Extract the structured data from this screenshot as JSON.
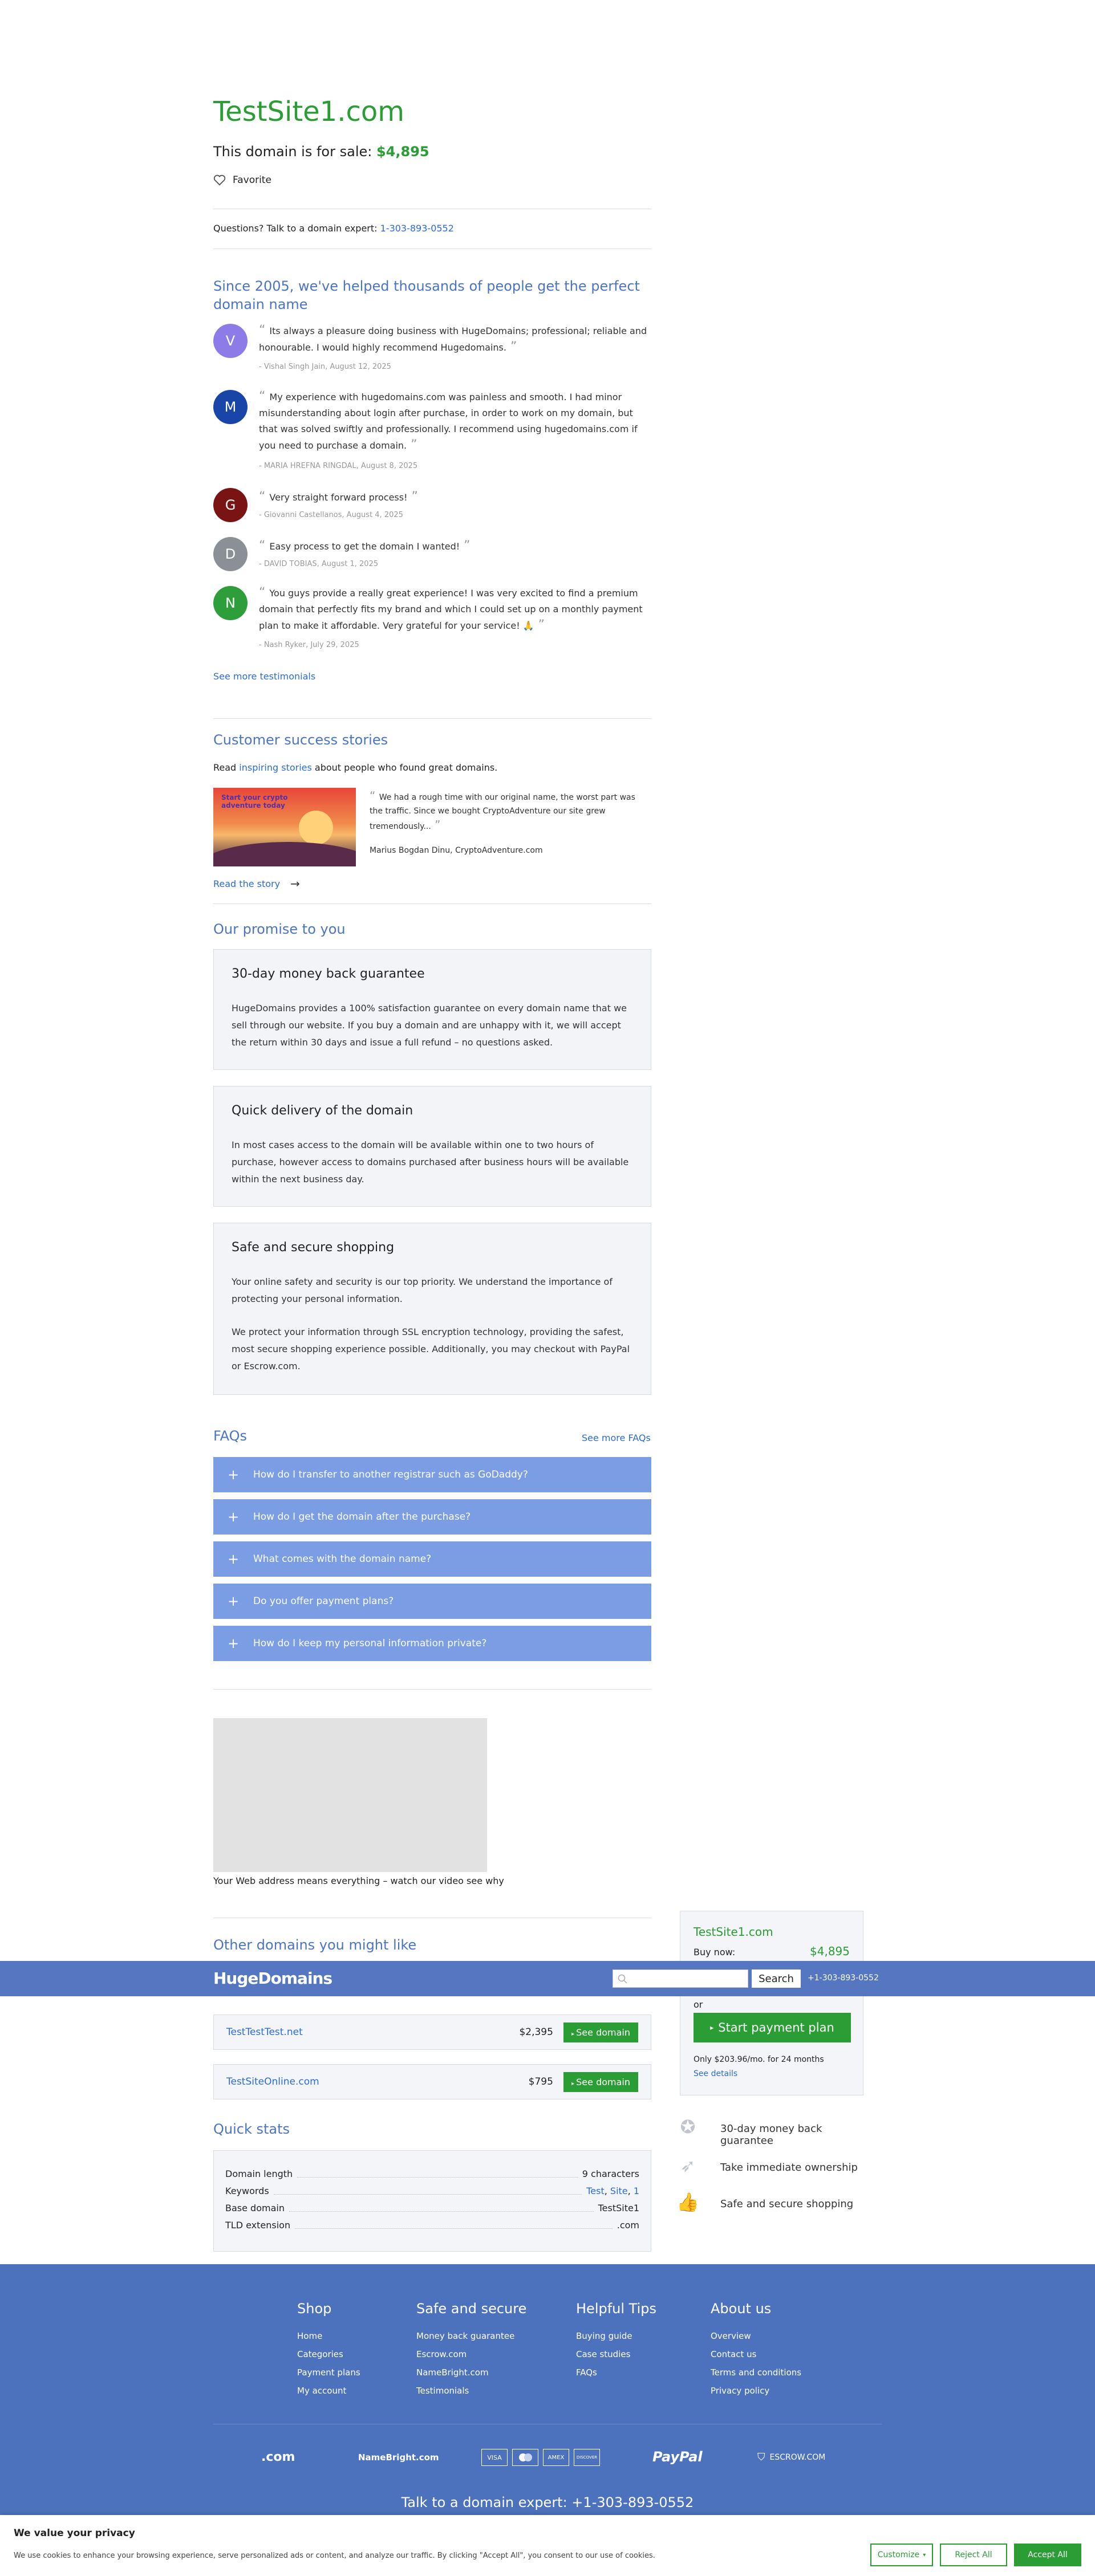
{
  "domain_title": "TestSite1.com",
  "sale_prefix": "This domain is for sale: ",
  "sale_price": "$4,895",
  "favorite": "Favorite",
  "questions_prefix": "Questions? Talk to a domain expert: ",
  "questions_phone": "1-303-893-0552",
  "testimonials_heading": "Since 2005, we've helped thousands of people get the perfect domain name",
  "testimonials": [
    {
      "initial": "V",
      "color": "#8d7ce8",
      "text": "Its always a pleasure doing business with HugeDomains; professional; reliable and honourable. I would highly recommend Hugedomains.",
      "meta": "- Vishal Singh Jain, August 12, 2025"
    },
    {
      "initial": "M",
      "color": "#1a45a8",
      "text": "My experience with hugedomains.com was painless and smooth. I had minor misunderstanding about login after purchase, in order to work on my domain, but that was solved swiftly and professionally. I recommend using hugedomains.com if you need to purchase a domain.",
      "meta": "- MARIA HREFNA RINGDAL, August 8, 2025"
    },
    {
      "initial": "G",
      "color": "#7a1414",
      "text": "Very straight forward process!",
      "meta": "- Giovanni Castellanos, August 4, 2025"
    },
    {
      "initial": "D",
      "color": "#8a9096",
      "text": "Easy process to get the domain I wanted!",
      "meta": "- DAVID TOBIAS, August 1, 2025"
    },
    {
      "initial": "N",
      "color": "#2e9e3a",
      "text": "You guys provide a really great experience! I was very excited to find a premium domain that perfectly fits my brand and which I could set up on a monthly payment plan to make it affordable. Very grateful for your service! 🙏",
      "meta": "- Nash Ryker, July 29, 2025"
    }
  ],
  "see_more_testimonials": "See more testimonials",
  "success_heading": "Customer success stories",
  "success_read": "Read ",
  "success_link": "inspiring stories",
  "success_rest": " about people who found great domains.",
  "success_image_text": "Start your crypto adventure today",
  "success_quote": "We had a rough time with our original name, the worst part was the traffic. Since we bought CryptoAdventure our site grew tremendously...",
  "success_author": "Marius Bogdan Dinu, CryptoAdventure.com",
  "read_story": "Read the story",
  "promise_heading": "Our promise to you",
  "promises": [
    {
      "title": "30-day money back guarantee",
      "text": "HugeDomains provides a 100% satisfaction guarantee on every domain name that we sell through our website. If you buy a domain and are unhappy with it, we will accept the return within 30 days and issue a full refund – no questions asked."
    },
    {
      "title": "Quick delivery of the domain",
      "text": "In most cases access to the domain will be available within one to two hours of purchase, however access to domains purchased after business hours will be available within the next business day."
    },
    {
      "title": "Safe and secure shopping",
      "text": "Your online safety and security is our top priority. We understand the importance of protecting your personal information.",
      "text2": "We protect your information through SSL encryption technology, providing the safest, most secure shopping experience possible. Additionally, you may checkout with PayPal or Escrow.com."
    }
  ],
  "faq_heading": "FAQs",
  "see_more_faqs": "See more FAQs",
  "faqs": [
    "How do I transfer to another registrar such as GoDaddy?",
    "How do I get the domain after the purchase?",
    "What comes with the domain name?",
    "Do you offer payment plans?",
    "How do I keep my personal information private?"
  ],
  "video_caption": "Your Web address means everything – watch our video see why",
  "other_heading": "Other domains you might like",
  "header_logo": "HugeDomains",
  "header_search_button": "Search",
  "header_phone": "+1-303-893-0552",
  "other_domains": [
    {
      "name": "TestTestTest.net",
      "price": "$2,395",
      "button": "See domain"
    },
    {
      "name": "TestSiteOnline.com",
      "price": "$795",
      "button": "See domain"
    }
  ],
  "stats_heading": "Quick stats",
  "stats": {
    "domain_length_k": "Domain length",
    "domain_length_v": "9 characters",
    "keywords_k": "Keywords",
    "kw1": "Test",
    "kw2": "Site",
    "kw3": "1",
    "base_k": "Base domain",
    "base_v": "TestSite1",
    "tld_k": "TLD extension",
    "tld_v": ".com"
  },
  "side": {
    "name": "TestSite1.com",
    "buy_now": "Buy now:",
    "price": "$4,895",
    "or": "or",
    "plan_button": "Start payment plan",
    "monthly": "Only $203.96/mo. for 24 months",
    "details": "See details"
  },
  "benefits": [
    "30-day money back guarantee",
    "Take immediate ownership",
    "Safe and secure shopping"
  ],
  "footer": {
    "cols": [
      {
        "title": "Shop",
        "links": [
          "Home",
          "Categories",
          "Payment plans",
          "My account"
        ]
      },
      {
        "title": "Safe and secure",
        "links": [
          "Money back guarantee",
          "Escrow.com",
          "NameBright.com",
          "Testimonials"
        ]
      },
      {
        "title": "Helpful Tips",
        "links": [
          "Buying guide",
          "Case studies",
          "FAQs"
        ]
      },
      {
        "title": "About us",
        "links": [
          "Overview",
          "Contact us",
          "Terms and conditions",
          "Privacy policy"
        ]
      }
    ],
    "logos": {
      "dotcom": ".com",
      "namebright": "NameBright.com",
      "visa": "VISA",
      "amex": "AMEX",
      "discover": "DISCOVER",
      "paypal": "PayPal",
      "escrow": "ESCROW.COM"
    },
    "expert": "Talk to a domain expert: +1-303-893-0552"
  },
  "cookie": {
    "title": "We value your privacy",
    "text": "We use cookies to enhance your browsing experience, serve personalized ads or content, and analyze our traffic. By clicking \"Accept All\", you consent to our use of cookies.",
    "customize": "Customize",
    "reject": "Reject All",
    "accept": "Accept All"
  },
  "colors": {
    "brand_blue": "#4d72bd",
    "green": "#2a9d34",
    "faq_blue": "#7a9de3"
  }
}
